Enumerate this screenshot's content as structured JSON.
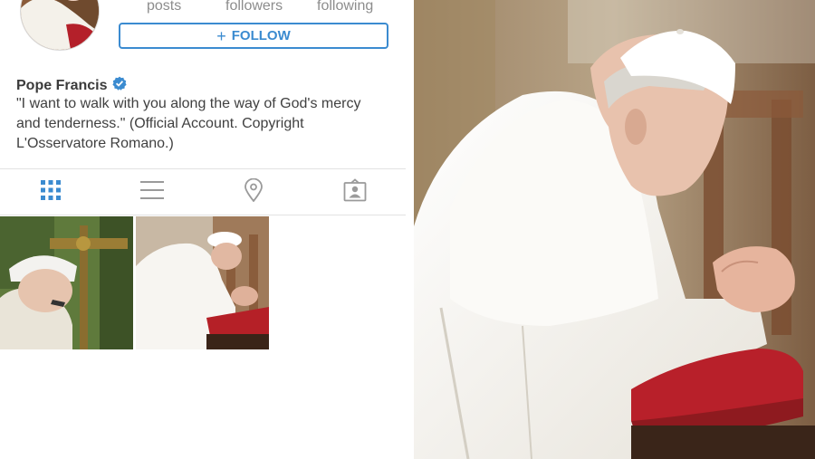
{
  "profile": {
    "name": "Pope Francis",
    "verified": true,
    "bio": "\"I want to walk with you along the way of God's mercy and tenderness.\" (Official Account. Copyright L'Osservatore Romano.)",
    "stats": {
      "posts_label": "posts",
      "followers_label": "followers",
      "following_label": "following"
    },
    "follow_button": {
      "icon": "plus-icon",
      "label": "FOLLOW"
    }
  },
  "tabs": [
    {
      "icon": "grid-view-icon",
      "active": true
    },
    {
      "icon": "list-view-icon",
      "active": false
    },
    {
      "icon": "location-pin-icon",
      "active": false
    },
    {
      "icon": "tagged-photos-icon",
      "active": false
    }
  ],
  "colors": {
    "accent": "#3b8bd0",
    "tab_active": "#3b8bd0",
    "tab_inactive": "#9a9a9a",
    "verified_badge": "#3b8bd0"
  },
  "posts": [
    {
      "subject": "pope-with-crucifix-photo"
    },
    {
      "subject": "pope-kneeling-prayer-photo"
    }
  ],
  "featured_photo": {
    "subject": "pope-kneeling-prayer-photo"
  }
}
